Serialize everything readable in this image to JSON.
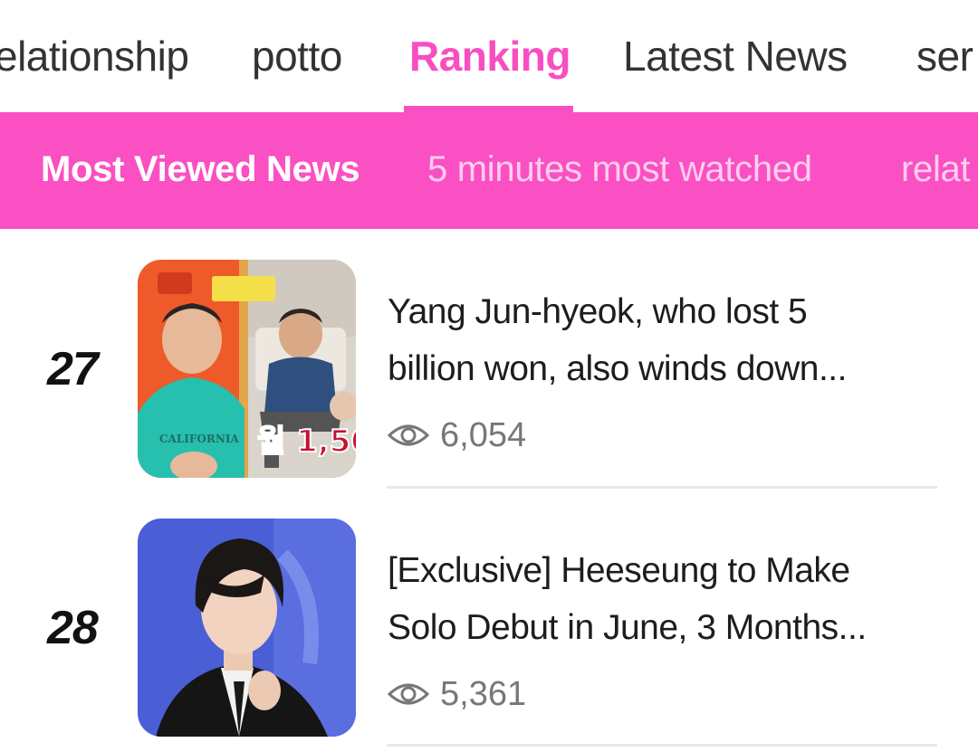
{
  "top_nav": {
    "tabs": [
      {
        "label": "elationship"
      },
      {
        "label": "potto"
      },
      {
        "label": "Ranking",
        "active": true
      },
      {
        "label": "Latest News"
      },
      {
        "label": "ser"
      }
    ]
  },
  "sub_nav": {
    "tabs": [
      {
        "label": "Most Viewed News",
        "active": true
      },
      {
        "label": "5 minutes most watched"
      },
      {
        "label": "relat"
      }
    ]
  },
  "articles": [
    {
      "rank": "27",
      "title_line1": "Yang Jun-hyeok, who lost 5",
      "title_line2": "billion won, also winds down...",
      "views": "6,054",
      "thumb_caption": "월 1,50",
      "thumb_shirt_text": "CALIFORNIA"
    },
    {
      "rank": "28",
      "title_line1": "[Exclusive] Heeseung to Make",
      "title_line2": "Solo Debut in June, 3 Months...",
      "views": "5,361"
    }
  ],
  "icons": {
    "views": "eye-icon"
  },
  "colors": {
    "accent": "#f74fc1",
    "subnav_bg": "#fa50c3"
  }
}
